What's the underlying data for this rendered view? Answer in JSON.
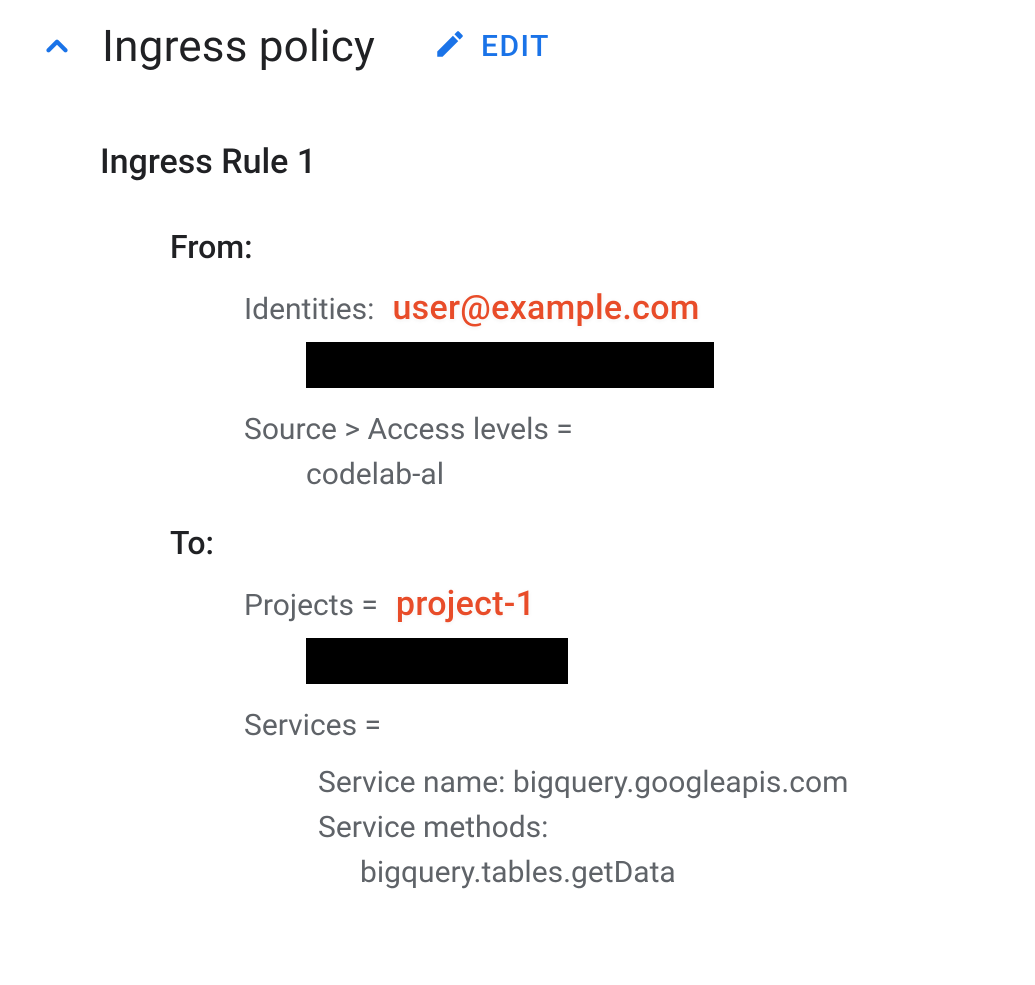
{
  "header": {
    "title": "Ingress policy",
    "edit_label": "EDIT"
  },
  "rule": {
    "title": "Ingress Rule 1",
    "from": {
      "label": "From:",
      "identities_label": "Identities:",
      "identities_annotation": "user@example.com",
      "source_access_label": "Source > Access levels =",
      "source_access_value": "codelab-al"
    },
    "to": {
      "label": "To:",
      "projects_label": "Projects =",
      "projects_annotation": "project-1",
      "services_label": "Services =",
      "service_name_label": "Service name:",
      "service_name_value": "bigquery.googleapis.com",
      "service_methods_label": "Service methods:",
      "service_method_value": "bigquery.tables.getData"
    }
  }
}
